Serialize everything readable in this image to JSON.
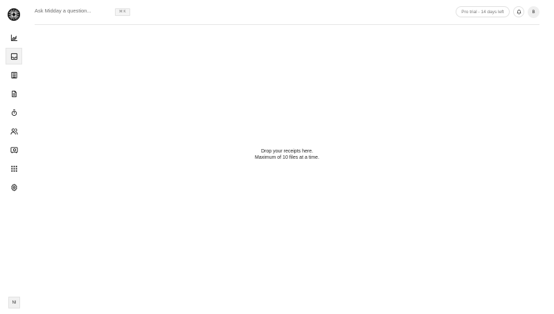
{
  "header": {
    "search_placeholder": "Ask Midday a question...",
    "shortcut": "⌘ K",
    "trial_badge": "Pro trial - 14 days left",
    "user_initial": "B"
  },
  "sidebar": {
    "items": [
      {
        "name": "overview",
        "icon": "chart-line-icon",
        "active": false
      },
      {
        "name": "inbox",
        "icon": "inbox-icon",
        "active": true
      },
      {
        "name": "transactions",
        "icon": "list-icon",
        "active": false
      },
      {
        "name": "invoices",
        "icon": "document-icon",
        "active": false
      },
      {
        "name": "tracker",
        "icon": "timer-icon",
        "active": false
      },
      {
        "name": "customers",
        "icon": "users-icon",
        "active": false
      },
      {
        "name": "vault",
        "icon": "vault-icon",
        "active": false
      },
      {
        "name": "apps",
        "icon": "grid-icon",
        "active": false
      },
      {
        "name": "settings",
        "icon": "gear-icon",
        "active": false
      }
    ],
    "team_initials": "NI"
  },
  "dropzone": {
    "line1": "Drop your receipts here.",
    "line2": "Maximum of 10 files at a time."
  },
  "colors": {
    "text": "#121212",
    "muted": "#6e6e6e",
    "border": "#e6e6e6",
    "active_bg": "#f2f2f2"
  }
}
